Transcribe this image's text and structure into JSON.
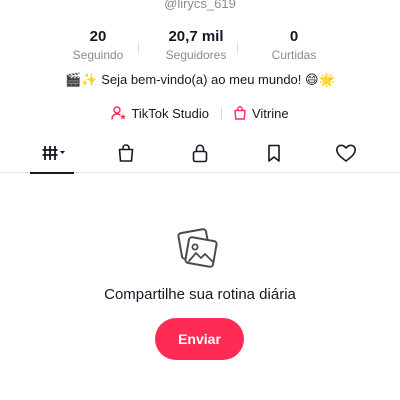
{
  "profile": {
    "username": "@lirycs_619",
    "stats": [
      {
        "value": "20",
        "label": "Seguindo"
      },
      {
        "value": "20,7 mil",
        "label": "Seguidores"
      },
      {
        "value": "0",
        "label": "Curtidas"
      }
    ],
    "bio": "🎬✨ Seja bem-vindo(a) ao meu mundo! 😄🌟"
  },
  "links": {
    "studio_label": "TikTok Studio",
    "showcase_label": "Vitrine"
  },
  "tabs": [
    {
      "icon": "grid-icon",
      "active": true
    },
    {
      "icon": "shopping-bag-icon",
      "active": false
    },
    {
      "icon": "lock-icon",
      "active": false
    },
    {
      "icon": "bookmark-icon",
      "active": false
    },
    {
      "icon": "heart-icon",
      "active": false
    }
  ],
  "empty_state": {
    "icon": "photos-icon",
    "title": "Compartilhe sua rotina diária",
    "button_label": "Enviar"
  },
  "colors": {
    "accent": "#fe2c55",
    "secondary_text": "#8a8b91",
    "primary_text": "#161823"
  }
}
